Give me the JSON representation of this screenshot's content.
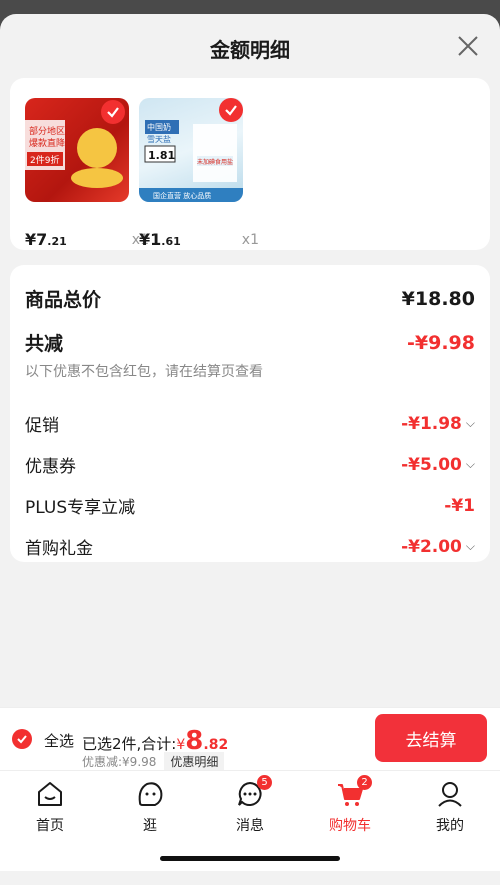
{
  "sheet": {
    "title": "金额明细"
  },
  "products": [
    {
      "price_main": "¥7",
      "price_dec": ".21",
      "qty": "x1",
      "image_text": [
        "部分地区",
        "爆款直降",
        "2件9折"
      ]
    },
    {
      "price_main": "¥1",
      "price_dec": ".61",
      "qty": "x1",
      "image_text": [
        "中国奶",
        "雪天盐",
        "1.81",
        "国企直营 放心品质",
        "未加碘食用盐"
      ]
    }
  ],
  "summary": {
    "total_label": "商品总价",
    "total_value": "¥18.80",
    "reduce_label": "共减",
    "reduce_value": "-¥9.98",
    "note": "以下优惠不包含红包，请在结算页查看",
    "items": [
      {
        "label": "促销",
        "value": "-¥1.98",
        "chevron": true
      },
      {
        "label": "优惠券",
        "value": "-¥5.00",
        "chevron": true
      },
      {
        "label": "PLUS专享立减",
        "value": "-¥1",
        "chevron": false
      },
      {
        "label": "首购礼金",
        "value": "-¥2.00",
        "chevron": true
      }
    ]
  },
  "bottom_bar": {
    "select_all": "全选",
    "selected_text": "已选2件,合计:",
    "total_sym": "¥",
    "total_int": "8",
    "total_dec": ".82",
    "discount_text": "优惠减:¥9.98",
    "detail_tag": "优惠明细",
    "checkout": "去结算"
  },
  "tabbar": [
    {
      "label": "首页",
      "icon": "home-icon",
      "badge": ""
    },
    {
      "label": "逛",
      "icon": "explore-icon",
      "badge": ""
    },
    {
      "label": "消息",
      "icon": "message-icon",
      "badge": "5"
    },
    {
      "label": "购物车",
      "icon": "cart-icon",
      "badge": "2"
    },
    {
      "label": "我的",
      "icon": "profile-icon",
      "badge": ""
    }
  ],
  "colors": {
    "accent": "#f23030",
    "background": "#f2f2f2"
  }
}
